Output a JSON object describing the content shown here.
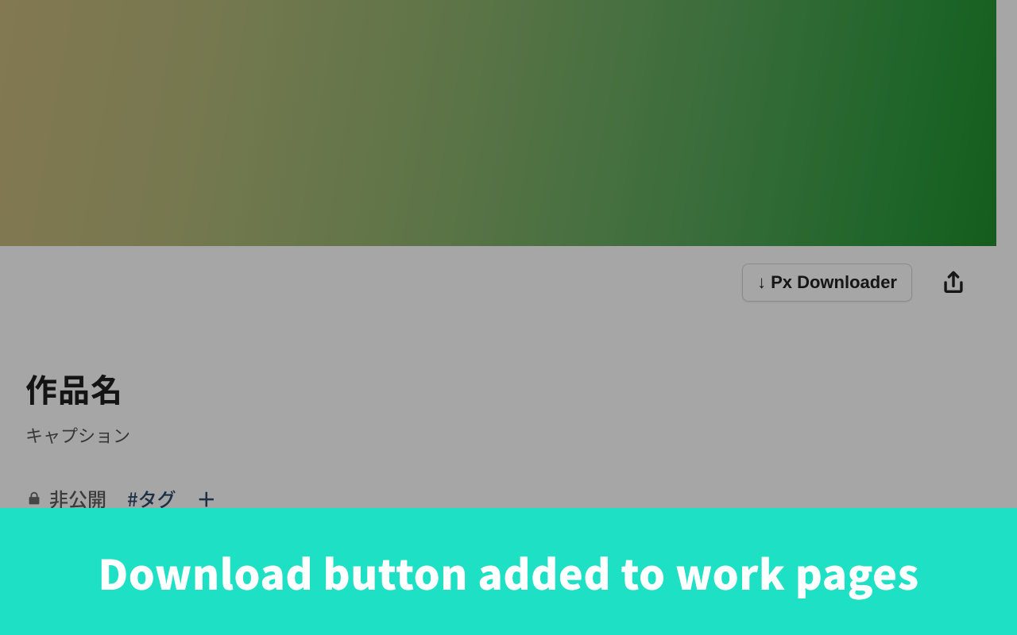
{
  "actions": {
    "px_downloader_label": "Px Downloader"
  },
  "work": {
    "title": "作品名",
    "caption": "キャプション",
    "privacy_label": "非公開",
    "tag_label": "#タグ"
  },
  "banner": {
    "text": "Download button added to work pages"
  },
  "colors": {
    "banner_bg": "#1ee0c5"
  }
}
